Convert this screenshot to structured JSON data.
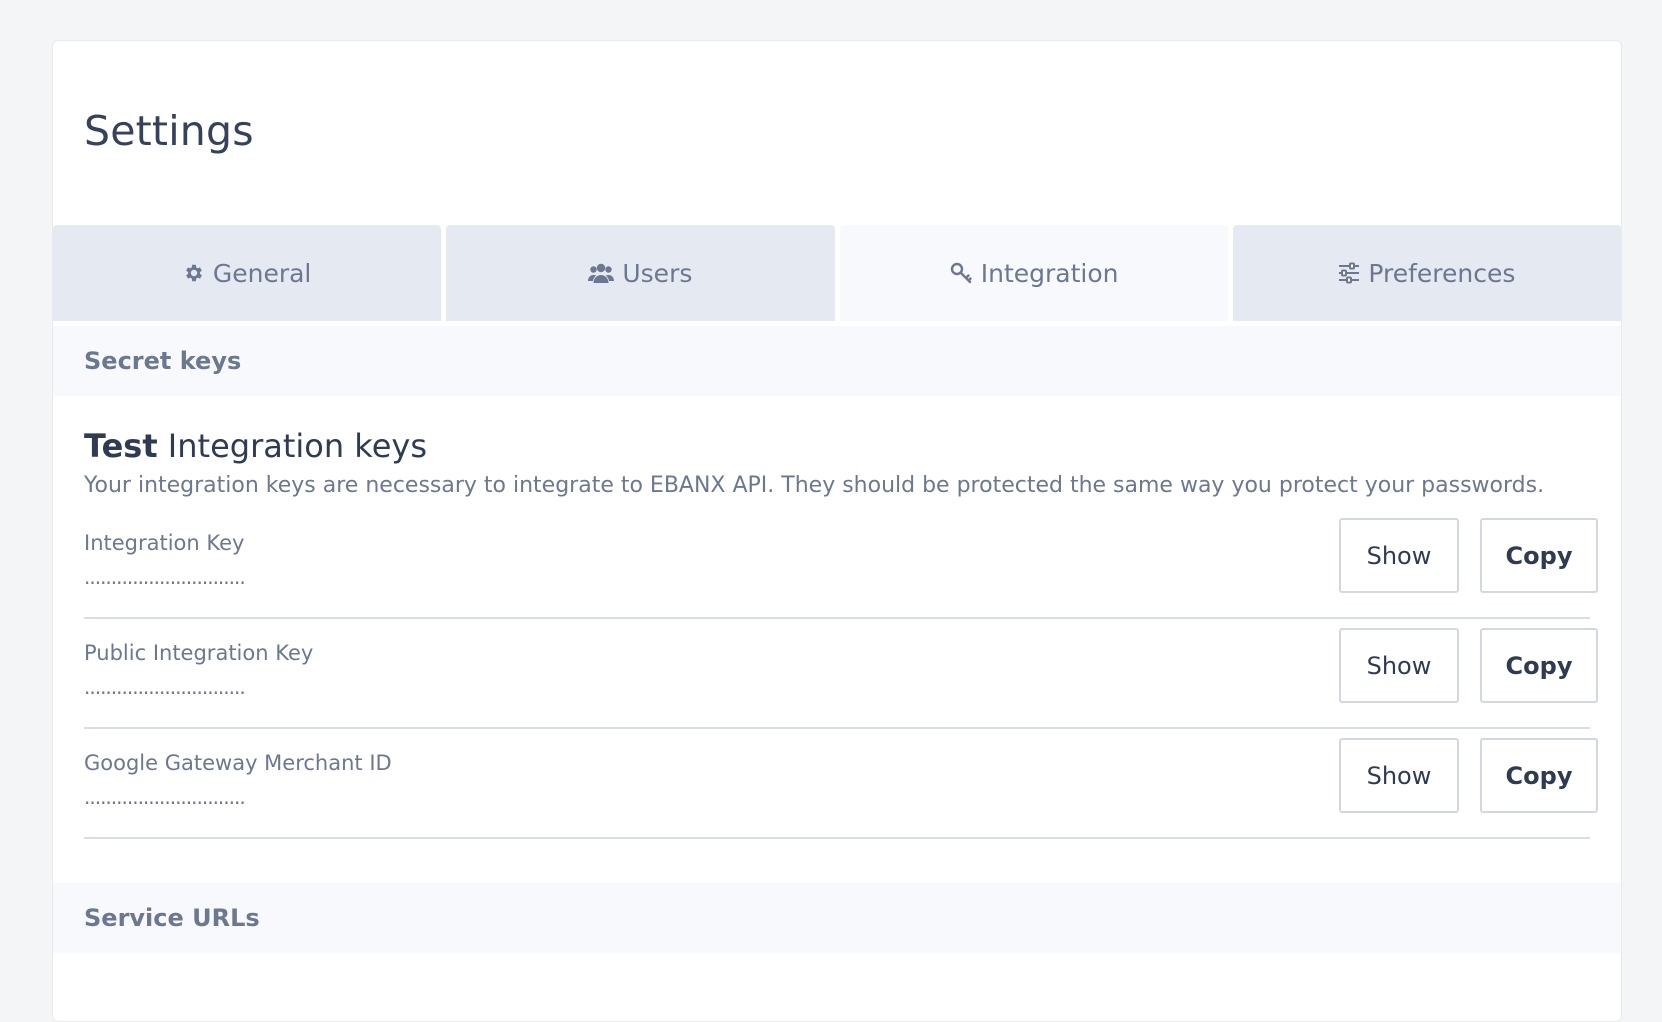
{
  "page": {
    "title": "Settings"
  },
  "tabs": [
    {
      "label": "General",
      "icon": "gear-icon"
    },
    {
      "label": "Users",
      "icon": "users-icon"
    },
    {
      "label": "Integration",
      "icon": "key-icon",
      "active": true
    },
    {
      "label": "Preferences",
      "icon": "sliders-icon"
    }
  ],
  "sections": {
    "secret_keys": "Secret keys",
    "service_urls": "Service URLs"
  },
  "integration_keys": {
    "title_bold": "Test",
    "title_rest": " Integration keys",
    "description": "Your integration keys are necessary to integrate to EBANX API. They should be protected the same way you protect your passwords.",
    "rows": [
      {
        "label": "Integration Key",
        "value": "..............................",
        "show_label": "Show",
        "copy_label": "Copy"
      },
      {
        "label": "Public Integration Key",
        "value": "..............................",
        "show_label": "Show",
        "copy_label": "Copy"
      },
      {
        "label": "Google Gateway Merchant ID",
        "value": "..............................",
        "show_label": "Show",
        "copy_label": "Copy"
      }
    ]
  },
  "colors": {
    "background": "#f4f5f7",
    "tab_inactive": "#e5e9f2",
    "tab_active": "#f8f9fc",
    "text_primary": "#2f3b53",
    "text_muted": "#6b7890"
  }
}
